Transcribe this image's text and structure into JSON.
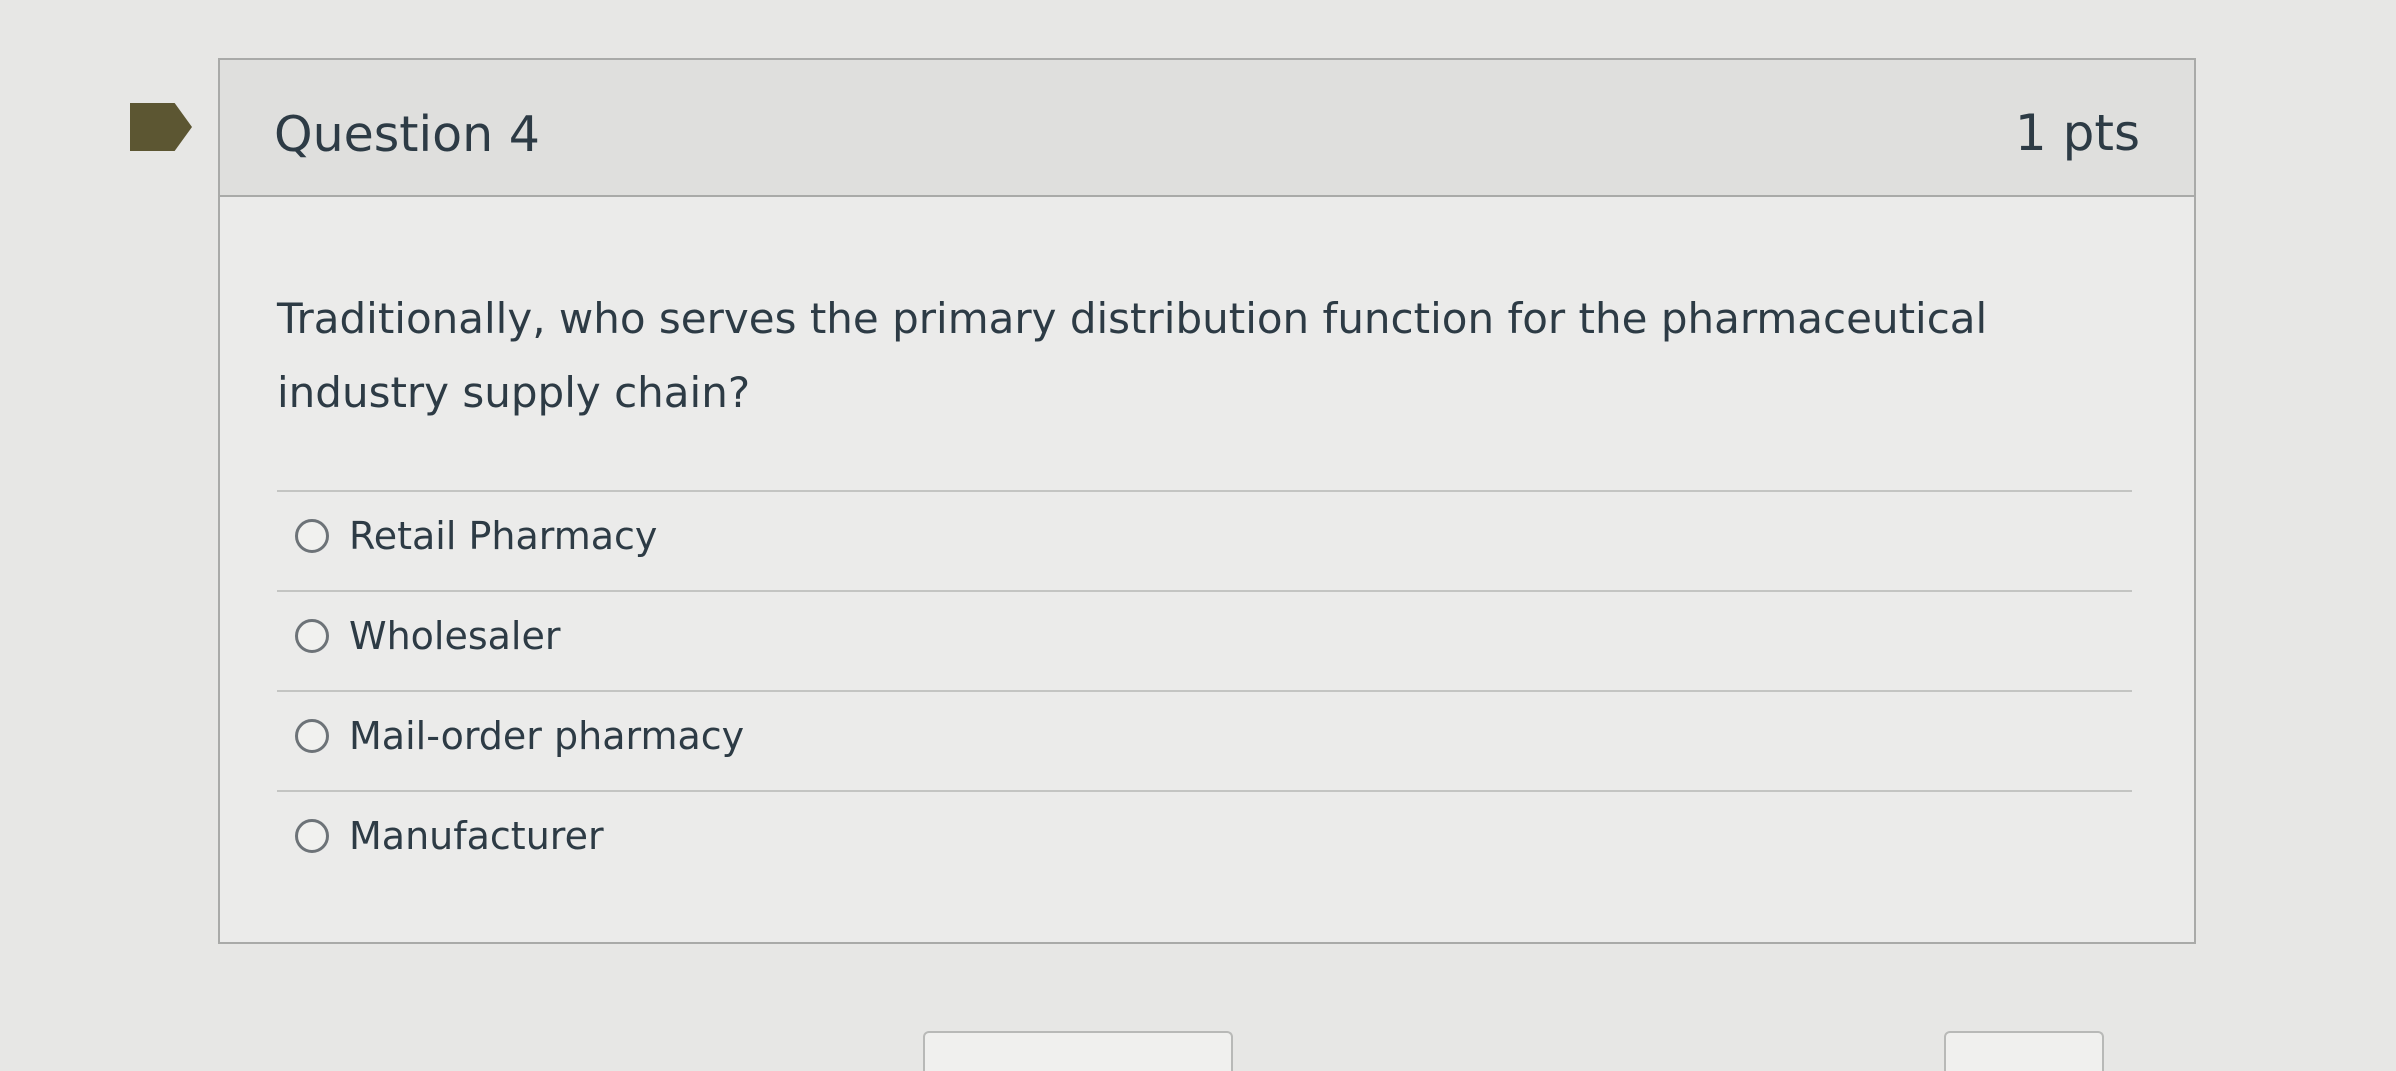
{
  "question": {
    "title": "Question 4",
    "points": "1 pts",
    "prompt": "Traditionally, who serves the primary distribution function for the pharmaceutical industry supply chain?",
    "answers": [
      {
        "label": "Retail Pharmacy",
        "selected": false
      },
      {
        "label": "Wholesaler",
        "selected": false
      },
      {
        "label": "Mail-order pharmacy",
        "selected": false
      },
      {
        "label": "Manufacturer",
        "selected": false
      }
    ]
  },
  "icons": {
    "flag": "bookmark-flag-icon",
    "radio": "radio-button-icon"
  },
  "colors": {
    "page_background": "#e7e7e5",
    "card_background": "#ebebea",
    "header_background": "#dfdfdd",
    "border": "#a9aaa8",
    "text": "#2d3b45",
    "flag": "#5c5632"
  }
}
